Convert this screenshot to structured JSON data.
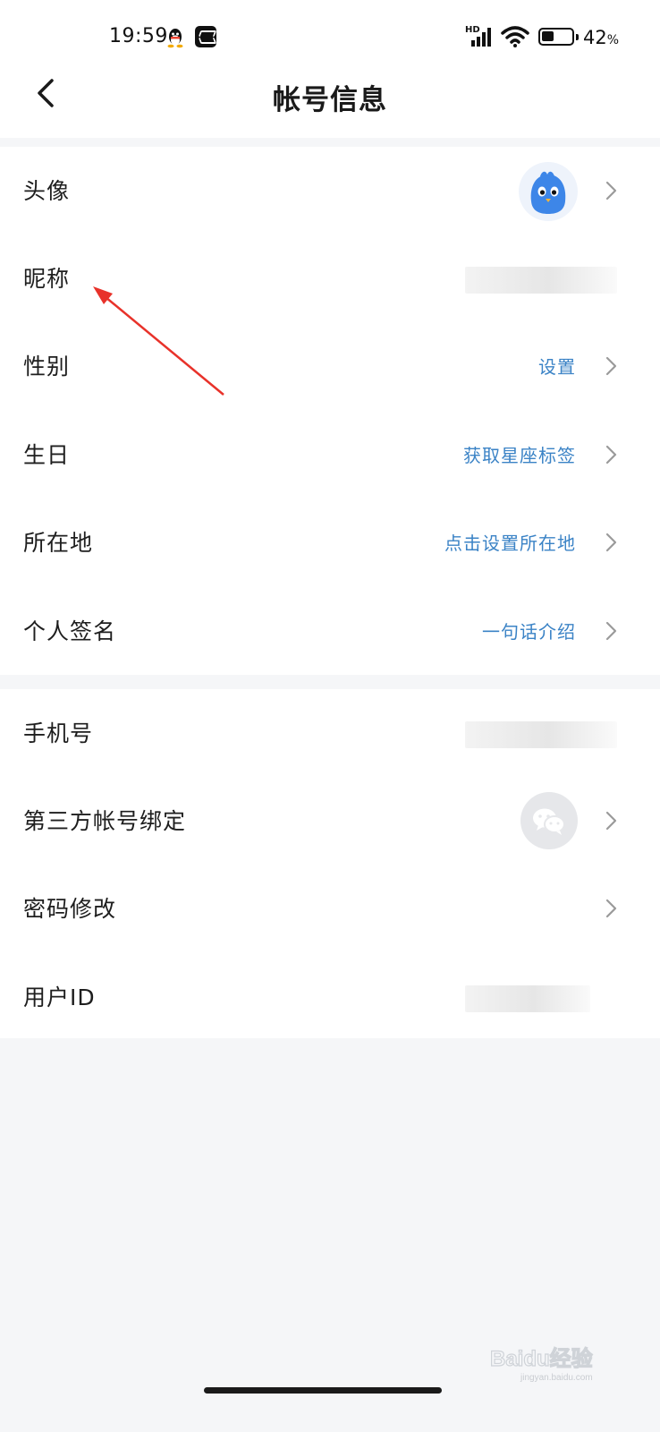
{
  "status_bar": {
    "time": "19:59",
    "network_label": "HD",
    "battery_percent": "42",
    "battery_unit": "%",
    "battery_level": 0.42
  },
  "nav": {
    "title": "帐号信息",
    "back_icon": "chevron-left-icon"
  },
  "profile_rows": [
    {
      "label": "头像",
      "value": "",
      "type": "avatar"
    },
    {
      "label": "昵称",
      "value": "",
      "type": "blurred"
    },
    {
      "label": "性别",
      "value": "设置"
    },
    {
      "label": "生日",
      "value": "获取星座标签"
    },
    {
      "label": "所在地",
      "value": "点击设置所在地"
    },
    {
      "label": "个人签名",
      "value": "一句话介绍"
    }
  ],
  "account_rows": [
    {
      "label": "手机号",
      "value": "",
      "type": "blurred"
    },
    {
      "label": "第三方帐号绑定",
      "value": "",
      "type": "wechat"
    },
    {
      "label": "密码修改",
      "value": ""
    },
    {
      "label": "用户ID",
      "value": "",
      "type": "blurred"
    }
  ],
  "watermark": {
    "text": "Baidu经验",
    "sub": "jingyan.baidu.com"
  },
  "colors": {
    "accent": "#3b83c6",
    "background": "#f5f6f8",
    "card": "#ffffff",
    "annotation_arrow": "#e8322a",
    "avatar_blue": "#3d86e8"
  }
}
